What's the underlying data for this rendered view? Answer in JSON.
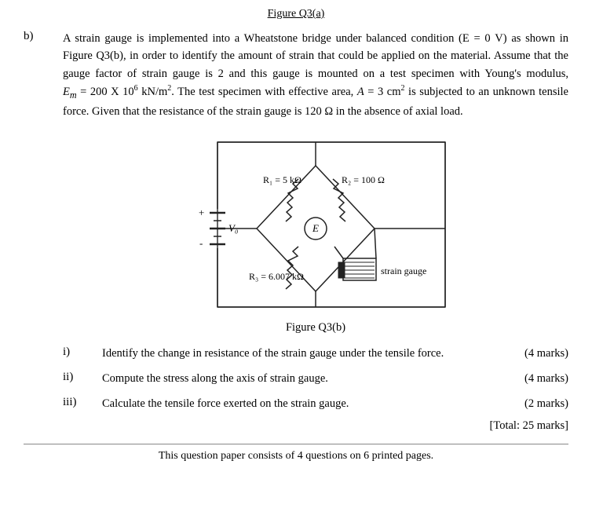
{
  "figure_top_title": "Figure Q3(a)",
  "section_b": {
    "label": "b)",
    "text_lines": [
      "A strain gauge is implemented into a Wheatstone bridge under balanced condition (E = 0 V)",
      "as shown in Figure Q3(b), in order to identify the amount of strain that could be applied on",
      "the material. Assume that the gauge factor of strain gauge is 2 and this gauge is mounted on a",
      "test specimen with Young's modulus, Em = 200 X 10⁶ kN/m². The test specimen with",
      "effective area, A = 3 cm² is subjected to an unknown tensile force. Given that the resistance of",
      "the strain gauge is 120 Ω in the absence of axial load."
    ]
  },
  "circuit": {
    "r1_label": "R₁ = 5 kΩ",
    "r2_label": "R₂ = 100 Ω",
    "r3_label": "R₃ = 6.007 kΩ",
    "vo_label": "V₀",
    "e_label": "E",
    "strain_gauge_label": "strain gauge",
    "plus_label": "+",
    "minus_label": "-"
  },
  "figure_caption": "Figure Q3(b)",
  "sub_items": [
    {
      "label": "i)",
      "text": "Identify the change in resistance of the strain gauge under the tensile force.",
      "marks": "(4 marks)"
    },
    {
      "label": "ii)",
      "text": "Compute the stress along the axis of strain gauge.",
      "marks": "(4 marks)"
    },
    {
      "label": "iii)",
      "text": "Calculate the tensile force exerted on the strain gauge.",
      "marks": "(2 marks)"
    }
  ],
  "total_marks": "[Total: 25 marks]",
  "footer_text": "This question paper consists of 4 questions on 6 printed pages."
}
